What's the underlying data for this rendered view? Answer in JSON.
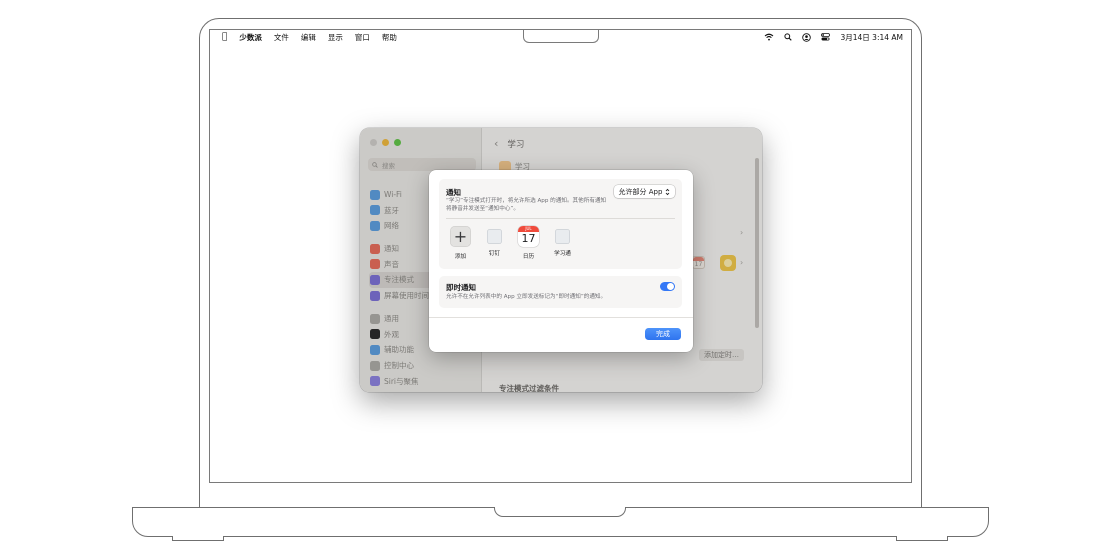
{
  "menubar": {
    "app_name": "少数派",
    "menus": [
      "文件",
      "编辑",
      "显示",
      "窗口",
      "帮助"
    ],
    "clock": "3月14日  3:14 AM"
  },
  "settings": {
    "search_placeholder": "搜索",
    "sidebar_groups": [
      [
        {
          "label": "Wi-Fi",
          "icon": "wifi-icon",
          "color": "#5b9ad8"
        },
        {
          "label": "蓝牙",
          "icon": "bluetooth-icon",
          "color": "#5b9ad8"
        },
        {
          "label": "网络",
          "icon": "globe-icon",
          "color": "#5b9ad8"
        }
      ],
      [
        {
          "label": "通知",
          "icon": "notification-icon",
          "color": "#e06a5a"
        },
        {
          "label": "声音",
          "icon": "sound-icon",
          "color": "#e06a5a"
        },
        {
          "label": "专注模式",
          "icon": "moon-icon",
          "color": "#7a6fd0",
          "active": true
        },
        {
          "label": "屏幕使用时间",
          "icon": "hourglass-icon",
          "color": "#7a6fd0"
        }
      ],
      [
        {
          "label": "通用",
          "icon": "gear-icon",
          "color": "#a8a6a2"
        },
        {
          "label": "外观",
          "icon": "appearance-icon",
          "color": "#2b2b2b"
        },
        {
          "label": "辅助功能",
          "icon": "accessibility-icon",
          "color": "#5b9ad8"
        },
        {
          "label": "控制中心",
          "icon": "control-center-icon",
          "color": "#a8a6a2"
        },
        {
          "label": "Siri与聚焦",
          "icon": "siri-icon",
          "color": "#8a7fd8"
        }
      ]
    ],
    "main_title": "学习",
    "focus_name": "学习",
    "add_schedule": "添加定时…",
    "filter_title": "专注模式过滤条件"
  },
  "sheet": {
    "notifications_title": "通知",
    "notifications_desc": "“学习”专注模式打开时，将允许所选 App 的通知。其他所有通知将静音并发送至“通知中心”。",
    "popup_value": "允许部分 App",
    "apps": [
      {
        "label": "添加",
        "kind": "add",
        "glyph": "+"
      },
      {
        "label": "钉钉",
        "kind": "blank"
      },
      {
        "label": "日历",
        "kind": "calendar",
        "month": "JUL",
        "day": "17"
      },
      {
        "label": "学习通",
        "kind": "blank"
      }
    ],
    "time_sensitive_title": "即时通知",
    "time_sensitive_desc": "允许不在允许列表中的 App 立即发送标记为“即时通知”的通知。",
    "time_sensitive_on": true,
    "done_label": "完成"
  },
  "colors": {
    "accent": "#3478f6",
    "traffic_yellow": "#e8b43e",
    "traffic_green": "#5fbf48"
  }
}
